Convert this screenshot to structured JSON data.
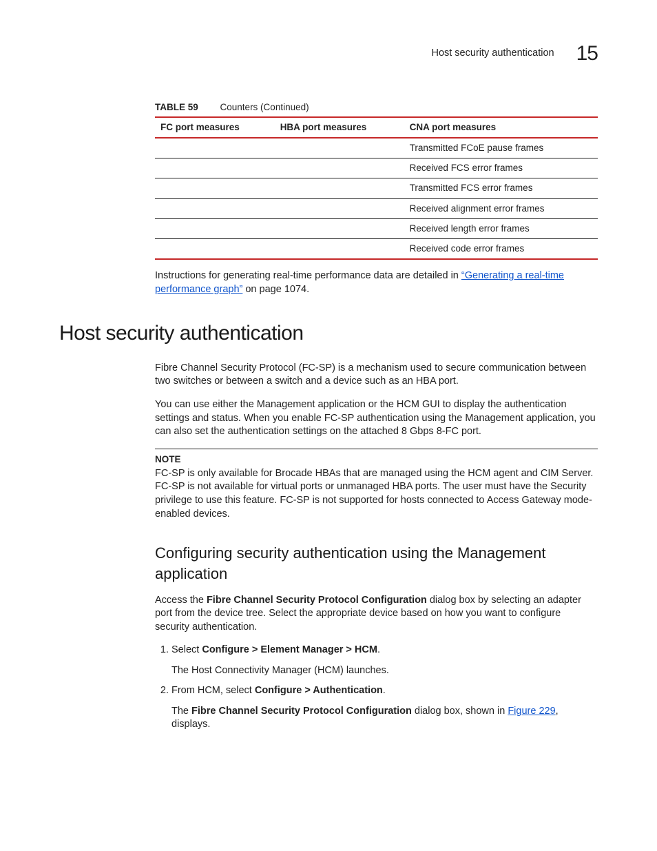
{
  "header": {
    "section_name": "Host security authentication",
    "chapter_number": "15"
  },
  "table": {
    "label": "TABLE 59",
    "caption": "Counters (Continued)",
    "columns": [
      "FC port measures",
      "HBA port measures",
      "CNA port measures"
    ],
    "rows": [
      [
        "",
        "",
        "Transmitted FCoE pause frames"
      ],
      [
        "",
        "",
        "Received FCS error frames"
      ],
      [
        "",
        "",
        "Transmitted FCS error frames"
      ],
      [
        "",
        "",
        "Received alignment error frames"
      ],
      [
        "",
        "",
        "Received length error frames"
      ],
      [
        "",
        "",
        "Received code error frames"
      ]
    ]
  },
  "instructions_sentence": {
    "prefix": "Instructions for generating real-time performance data are detailed in ",
    "link_text": "“Generating a real-time performance graph”",
    "suffix": " on page 1074."
  },
  "h1": "Host security authentication",
  "intro_p1": "Fibre Channel Security Protocol (FC-SP) is a mechanism used to secure communication between two switches or between a switch and a device such as an HBA port.",
  "intro_p2": "You can use either the Management application or the HCM GUI to display the authentication settings and status. When you enable FC-SP authentication using the Management application, you can also set the authentication settings on the attached 8 Gbps 8-FC port.",
  "note": {
    "label": "NOTE",
    "body": "FC-SP is only available for Brocade HBAs that are managed using the HCM agent and CIM Server. FC-SP is not available for virtual ports or unmanaged HBA ports. The user must have the Security privilege to use this feature. FC-SP is not supported for hosts connected to Access Gateway mode-enabled devices."
  },
  "h2": "Configuring security authentication using the Management application",
  "config_intro": {
    "prefix": "Access the ",
    "bold1": "Fibre Channel Security Protocol Configuration",
    "suffix": " dialog box by selecting an adapter port from the device tree. Select the appropriate device based on how you want to configure security authentication."
  },
  "steps": [
    {
      "instruction_prefix": "Select ",
      "instruction_bold": "Configure > Element Manager > HCM",
      "instruction_suffix": ".",
      "result": "The Host Connectivity Manager (HCM) launches."
    },
    {
      "instruction_prefix": "From HCM, select ",
      "instruction_bold": "Configure > Authentication",
      "instruction_suffix": ".",
      "result_prefix": "The ",
      "result_bold": "Fibre Channel Security Protocol Configuration",
      "result_mid": " dialog box, shown in ",
      "result_link": "Figure 229",
      "result_suffix": ", displays."
    }
  ]
}
